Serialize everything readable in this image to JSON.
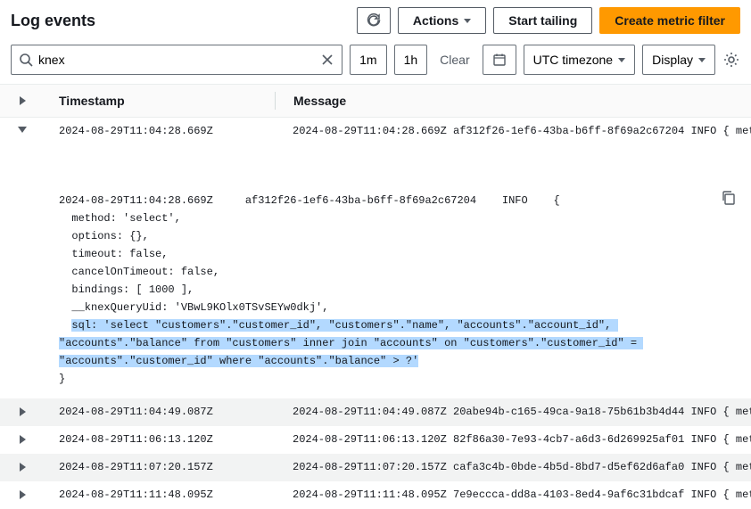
{
  "header": {
    "title": "Log events",
    "actions_label": "Actions",
    "start_tailing": "Start tailing",
    "create_filter": "Create metric filter"
  },
  "search": {
    "value": "knex"
  },
  "toolbar": {
    "range_1m": "1m",
    "range_1h": "1h",
    "clear": "Clear",
    "timezone": "UTC timezone",
    "display": "Display"
  },
  "table": {
    "th_timestamp": "Timestamp",
    "th_message": "Message"
  },
  "rows": [
    {
      "expanded": true,
      "timestamp": "2024-08-29T11:04:28.669Z",
      "message": "2024-08-29T11:04:28.669Z af312f26-1ef6-43ba-b6ff-8f69a2c67204 INFO { met"
    },
    {
      "expanded": false,
      "timestamp": "2024-08-29T11:04:49.087Z",
      "message": "2024-08-29T11:04:49.087Z 20abe94b-c165-49ca-9a18-75b61b3b4d44 INFO { met"
    },
    {
      "expanded": false,
      "timestamp": "2024-08-29T11:06:13.120Z",
      "message": "2024-08-29T11:06:13.120Z 82f86a30-7e93-4cb7-a6d3-6d269925af01 INFO { met"
    },
    {
      "expanded": false,
      "timestamp": "2024-08-29T11:07:20.157Z",
      "message": "2024-08-29T11:07:20.157Z cafa3c4b-0bde-4b5d-8bd7-d5ef62d6afa0 INFO { met"
    },
    {
      "expanded": false,
      "timestamp": "2024-08-29T11:11:48.095Z",
      "message": "2024-08-29T11:11:48.095Z 7e9eccca-dd8a-4103-8ed4-9af6c31bdcaf INFO { met"
    }
  ],
  "expanded": {
    "line_head": "2024-08-29T11:04:28.669Z     af312f26-1ef6-43ba-b6ff-8f69a2c67204    INFO    {",
    "line_method": "  method: 'select',",
    "line_options": "  options: {},",
    "line_timeout": "  timeout: false,",
    "line_cancel": "  cancelOnTimeout: false,",
    "line_bindings": "  bindings: [ 1000 ],",
    "line_uid": "  __knexQueryUid: 'VBwL9KOlx0TSvSEYw0dkj',",
    "sql_prefix": "  ",
    "sql_highlight": "sql: 'select \"customers\".\"customer_id\", \"customers\".\"name\", \"accounts\".\"account_id\", \"accounts\".\"balance\" from \"customers\" inner join \"accounts\" on \"customers\".\"customer_id\" = \"accounts\".\"customer_id\" where \"accounts\".\"balance\" > ?'",
    "line_close": "}"
  }
}
